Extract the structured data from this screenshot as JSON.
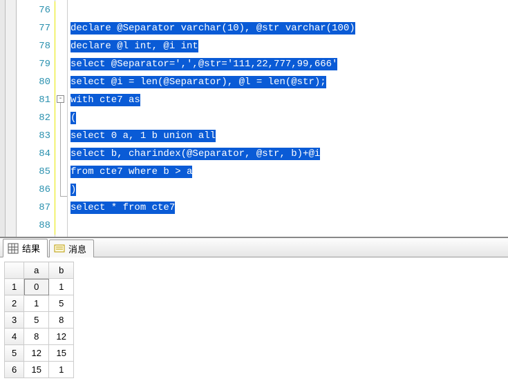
{
  "editor": {
    "lines": [
      {
        "num": 76,
        "text": "",
        "selected": false
      },
      {
        "num": 77,
        "text": "declare @Separator varchar(10), @str varchar(100)",
        "selected": true
      },
      {
        "num": 78,
        "text": "declare @l int, @i int",
        "selected": true
      },
      {
        "num": 79,
        "text": "select @Separator=',',@str='111,22,777,99,666'",
        "selected": true
      },
      {
        "num": 80,
        "text": "select @i = len(@Separator), @l = len(@str);",
        "selected": true
      },
      {
        "num": 81,
        "text": "with cte7 as",
        "selected": true
      },
      {
        "num": 82,
        "text": "(",
        "selected": true
      },
      {
        "num": 83,
        "text": "select 0 a, 1 b union all",
        "selected": true
      },
      {
        "num": 84,
        "text": "select b, charindex(@Separator, @str, b)+@i",
        "selected": true
      },
      {
        "num": 85,
        "text": "from cte7 where b > a",
        "selected": true
      },
      {
        "num": 86,
        "text": ")",
        "selected": true
      },
      {
        "num": 87,
        "text": "select * from cte7",
        "selected": true
      },
      {
        "num": 88,
        "text": "",
        "selected": false
      }
    ]
  },
  "tabs": {
    "results": "结果",
    "messages": "消息"
  },
  "grid": {
    "columns": [
      "a",
      "b"
    ],
    "rows": [
      {
        "n": 1,
        "a": 0,
        "b": 1
      },
      {
        "n": 2,
        "a": 1,
        "b": 5
      },
      {
        "n": 3,
        "a": 5,
        "b": 8
      },
      {
        "n": 4,
        "a": 8,
        "b": 12
      },
      {
        "n": 5,
        "a": 12,
        "b": 15
      },
      {
        "n": 6,
        "a": 15,
        "b": 1
      }
    ]
  }
}
